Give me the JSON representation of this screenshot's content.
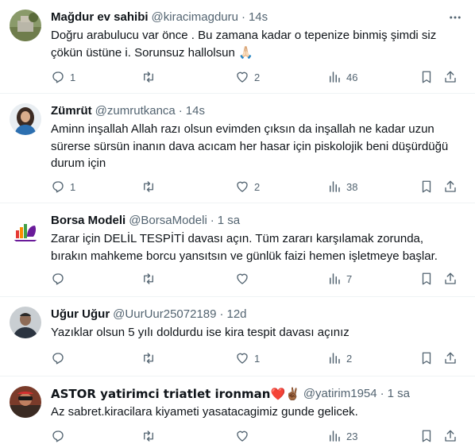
{
  "tweets": [
    {
      "name": "Mağdur ev sahibi",
      "handle": "@kiracimagduru",
      "time": "14s",
      "text": "Doğru arabulucu var önce . Bu zamana kadar o tepenize binmiş şimdi siz\nçökün üstüne i. Sorunsuz hallolsun 🙏🏻",
      "replies": "1",
      "retweets": "",
      "likes": "2",
      "views": "46"
    },
    {
      "name": "Zümrüt",
      "handle": "@zumrutkanca",
      "time": "14s",
      "text": "Aminn inşallah Allah razı olsun evimden çıksın da inşallah ne kadar uzun\nsürerse sürsün inanın dava acıcam her hasar için piskolojik beni düşürdüğü\ndurum için",
      "replies": "1",
      "retweets": "",
      "likes": "2",
      "views": "38"
    },
    {
      "name": "Borsa Modeli",
      "handle": "@BorsaModeli",
      "time": "1 sa",
      "text": "Zarar için DELİL TESPİTİ davası açın. Tüm zararı karşılamak zorunda,\nbırakın mahkeme borcu yansıtsın ve günlük faizi hemen işletmeye başlar.",
      "replies": "",
      "retweets": "",
      "likes": "",
      "views": "7"
    },
    {
      "name": "Uğur Uğur",
      "handle": "@UurUur25072189",
      "time": "12d",
      "text": "Yazıklar olsun 5 yılı doldurdu ise kira tespit davası açınız",
      "replies": "",
      "retweets": "",
      "likes": "1",
      "views": "2"
    },
    {
      "name": "ASTOR yatirimci triatlet ironman❤️✌🏾",
      "handle": "@yatirim1954",
      "time": "1 sa",
      "text": "Az sabret.kiracilara kiyameti yasatacagimiz gunde gelicek.",
      "replies": "",
      "retweets": "",
      "likes": "",
      "views": "23"
    }
  ],
  "separator": "·",
  "icons": {
    "reply": "reply-icon",
    "retweet": "retweet-icon",
    "like": "like-icon",
    "views": "views-icon",
    "bookmark": "bookmark-icon",
    "share": "share-icon",
    "more": "more-icon"
  },
  "colors": {
    "text": "#0f1419",
    "secondary": "#536471",
    "border": "#eff3f4"
  }
}
